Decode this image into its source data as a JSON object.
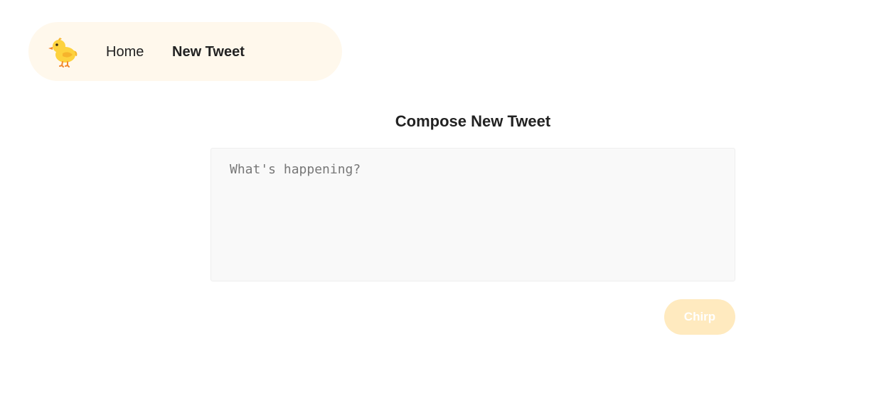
{
  "nav": {
    "logo_icon": "baby-chick-icon",
    "items": [
      {
        "label": "Home"
      },
      {
        "label": "New Tweet"
      }
    ],
    "background": "#fff8ec"
  },
  "compose": {
    "title": "Compose New Tweet",
    "placeholder": "What's happening?",
    "value": "",
    "submit_label": "Chirp"
  },
  "colors": {
    "button_disabled": "#ffeabf",
    "text": "#222222"
  }
}
